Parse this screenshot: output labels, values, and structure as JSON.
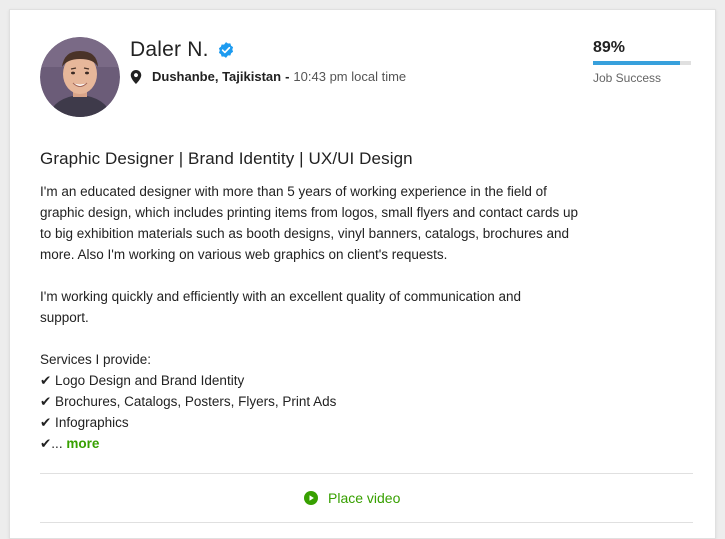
{
  "profile": {
    "name": "Daler N.",
    "location": "Dushanbe, Tajikistan",
    "separator": "-",
    "local_time": "10:43 pm local time"
  },
  "job_success": {
    "percent_label": "89%",
    "value": 0.89,
    "label": "Job Success",
    "bar_color": "#37a0dc"
  },
  "overview": {
    "title": "Graphic Designer | Brand Identity | UX/UI Design",
    "para1_lines": [
      "I'm an educated designer with more than 5 years of working experience in the field of",
      "graphic design, which includes printing items from logos, small flyers and contact cards up",
      "to big exhibition materials such as booth designs, vinyl banners, catalogs, brochures and",
      "more. Also I'm working on various web graphics on client's requests."
    ],
    "para2_lines": [
      "I'm working quickly and efficiently with an excellent quality of communication and",
      "support."
    ],
    "services_heading": "Services I provide:",
    "services": [
      "✔ Logo Design and Brand Identity",
      "✔ Brochures, Catalogs, Posters, Flyers, Print Ads",
      "✔ Infographics"
    ],
    "truncated_prefix": "✔...",
    "more_label": "more"
  },
  "video": {
    "label": "Place video"
  },
  "colors": {
    "accent_green": "#37a000",
    "verified_blue": "#1d9bf0",
    "bar_blue": "#37a0dc"
  },
  "icons": {
    "verified": "verified-badge-icon",
    "location": "map-pin-icon",
    "play": "play-circle-icon"
  }
}
